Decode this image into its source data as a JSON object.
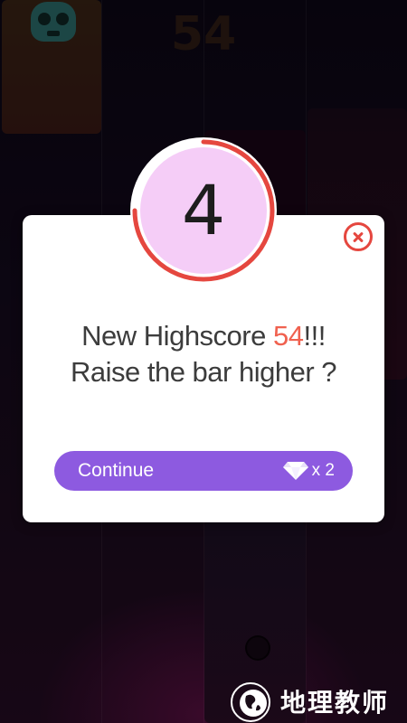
{
  "background": {
    "score": "54"
  },
  "timer": {
    "value": "4",
    "remaining_fraction": 0.75
  },
  "dialog": {
    "message_prefix": "New Highscore ",
    "highscore": "54",
    "message_suffix": "!!!",
    "message_line2": "Raise the bar higher ?",
    "continue_label": "Continue",
    "cost": "x 2",
    "close_icon": "close-icon"
  },
  "watermark": {
    "text": "地理教师"
  },
  "colors": {
    "accent": "#8d5ae0",
    "highlight": "#f0614f",
    "timer_ring": "#e5473f",
    "timer_fill": "#f5cdf7"
  }
}
